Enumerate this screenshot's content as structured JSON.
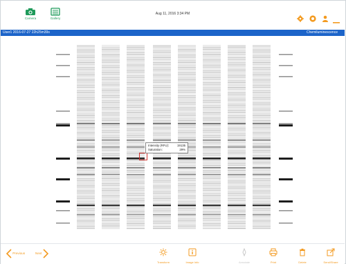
{
  "header": {
    "camera_label": "Camera",
    "gallery_label": "Gallery",
    "datetime": "Aug 11, 2016  3:34 PM"
  },
  "titlebar": {
    "image_name": "User1 2016-07-27 22h25m39s",
    "mode": "Chemiluminescence"
  },
  "tooltip": {
    "intensity_label": "Intensity (RFU):",
    "intensity_value": "19135",
    "saturation_label": "Saturation:",
    "saturation_value": "29%"
  },
  "footer": {
    "previous_label": "Previous",
    "next_label": "Next",
    "tools": [
      {
        "label": "Transform",
        "icon": "transform-icon",
        "enabled": true
      },
      {
        "label": "Image Info",
        "icon": "image-info-icon",
        "enabled": true
      },
      {
        "label": "Annotate",
        "icon": "annotate-icon",
        "enabled": false
      },
      {
        "label": "Print",
        "icon": "print-icon",
        "enabled": true
      },
      {
        "label": "Delete",
        "icon": "delete-icon",
        "enabled": true
      },
      {
        "label": "Send/Share",
        "icon": "share-icon",
        "enabled": true
      }
    ]
  },
  "colors": {
    "brand_green": "#1e9a5a",
    "accent_orange": "#f39a1f",
    "title_blue": "#1c64c9",
    "selection_red": "#d0312d"
  }
}
